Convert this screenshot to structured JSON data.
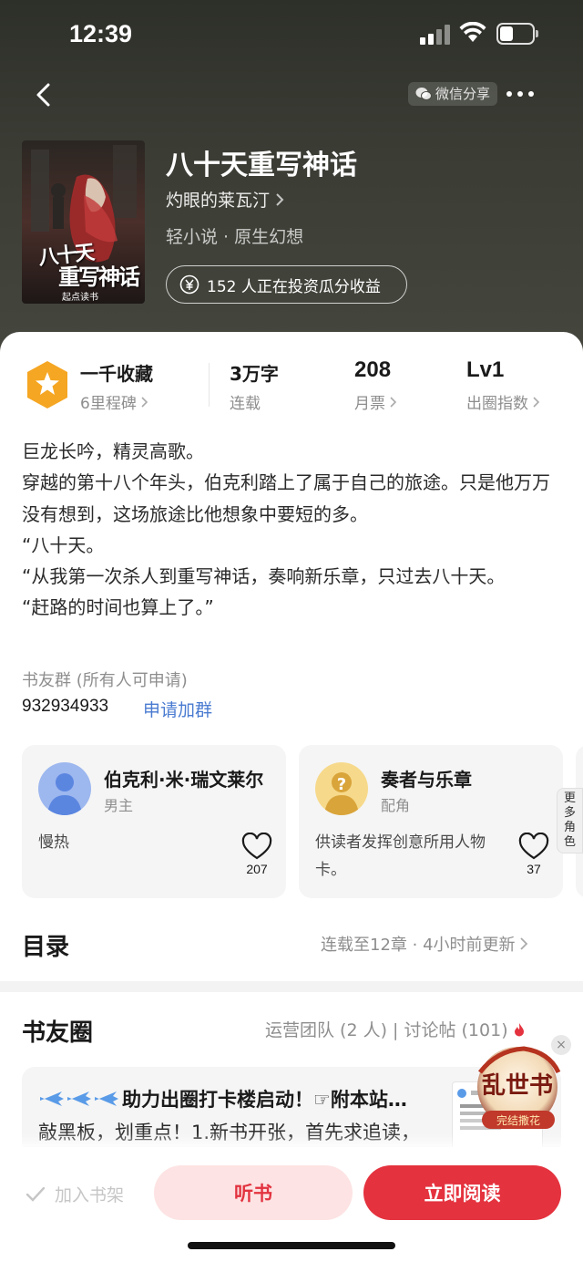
{
  "status_bar": {
    "time": "12:39"
  },
  "header": {
    "share_label": "微信分享"
  },
  "book": {
    "title": "八十天重写神话",
    "author": "灼眼的莱瓦汀",
    "genre": "轻小说 · 原生幻想",
    "invest_text": "152 人正在投资瓜分收益",
    "cover": {
      "title_line1": "八十天",
      "title_line2": "重写神话",
      "publisher": "起点读书"
    }
  },
  "stats": {
    "badge_title": "一千收藏",
    "badge_sub": "6里程碑",
    "words_value": "3万字",
    "words_label": "连载",
    "tickets_value": "208",
    "tickets_label": "月票",
    "level_value": "Lv1",
    "level_label": "出圈指数"
  },
  "description": [
    "巨龙长吟，精灵高歌。",
    "穿越的第十八个年头，伯克利踏上了属于自己的旅途。只是他万万没有想到，这场旅途比他想象中要短的多。",
    "“八十天。",
    "“从我第一次杀人到重写神话，奏响新乐章，只过去八十天。",
    "“赶路的时间也算上了。”"
  ],
  "group": {
    "label": "书友群 (所有人可申请)",
    "number": "932934933",
    "join_label": "申请加群"
  },
  "roles": [
    {
      "name": "伯克利·米·瑞文莱尔",
      "type": "男主",
      "desc": "慢热",
      "likes": "207"
    },
    {
      "name": "奏者与乐章",
      "type": "配角",
      "desc": "供读者发挥创意所用人物卡。",
      "likes": "37"
    }
  ],
  "more_roles_label": "更多角色",
  "toc": {
    "title": "目录",
    "info": "连载至12章 · 4小时前更新"
  },
  "circle": {
    "title": "书友圈",
    "info": "运营团队 (2 人) | 讨论帖 (101)",
    "post_title": "助力出圈打卡楼启动！☞附本站…",
    "post_body": "敲黑板，划重点！1.新书开张，首先求追读，"
  },
  "float_ad": {
    "title": "乱世书",
    "tag": "完结撒花"
  },
  "bottom_bar": {
    "shelf_label": "加入书架",
    "listen_label": "听书",
    "read_label": "立即阅读"
  },
  "colors": {
    "accent_red": "#e4323e",
    "link_blue": "#4a7bd1",
    "badge_orange": "#f5a623"
  }
}
